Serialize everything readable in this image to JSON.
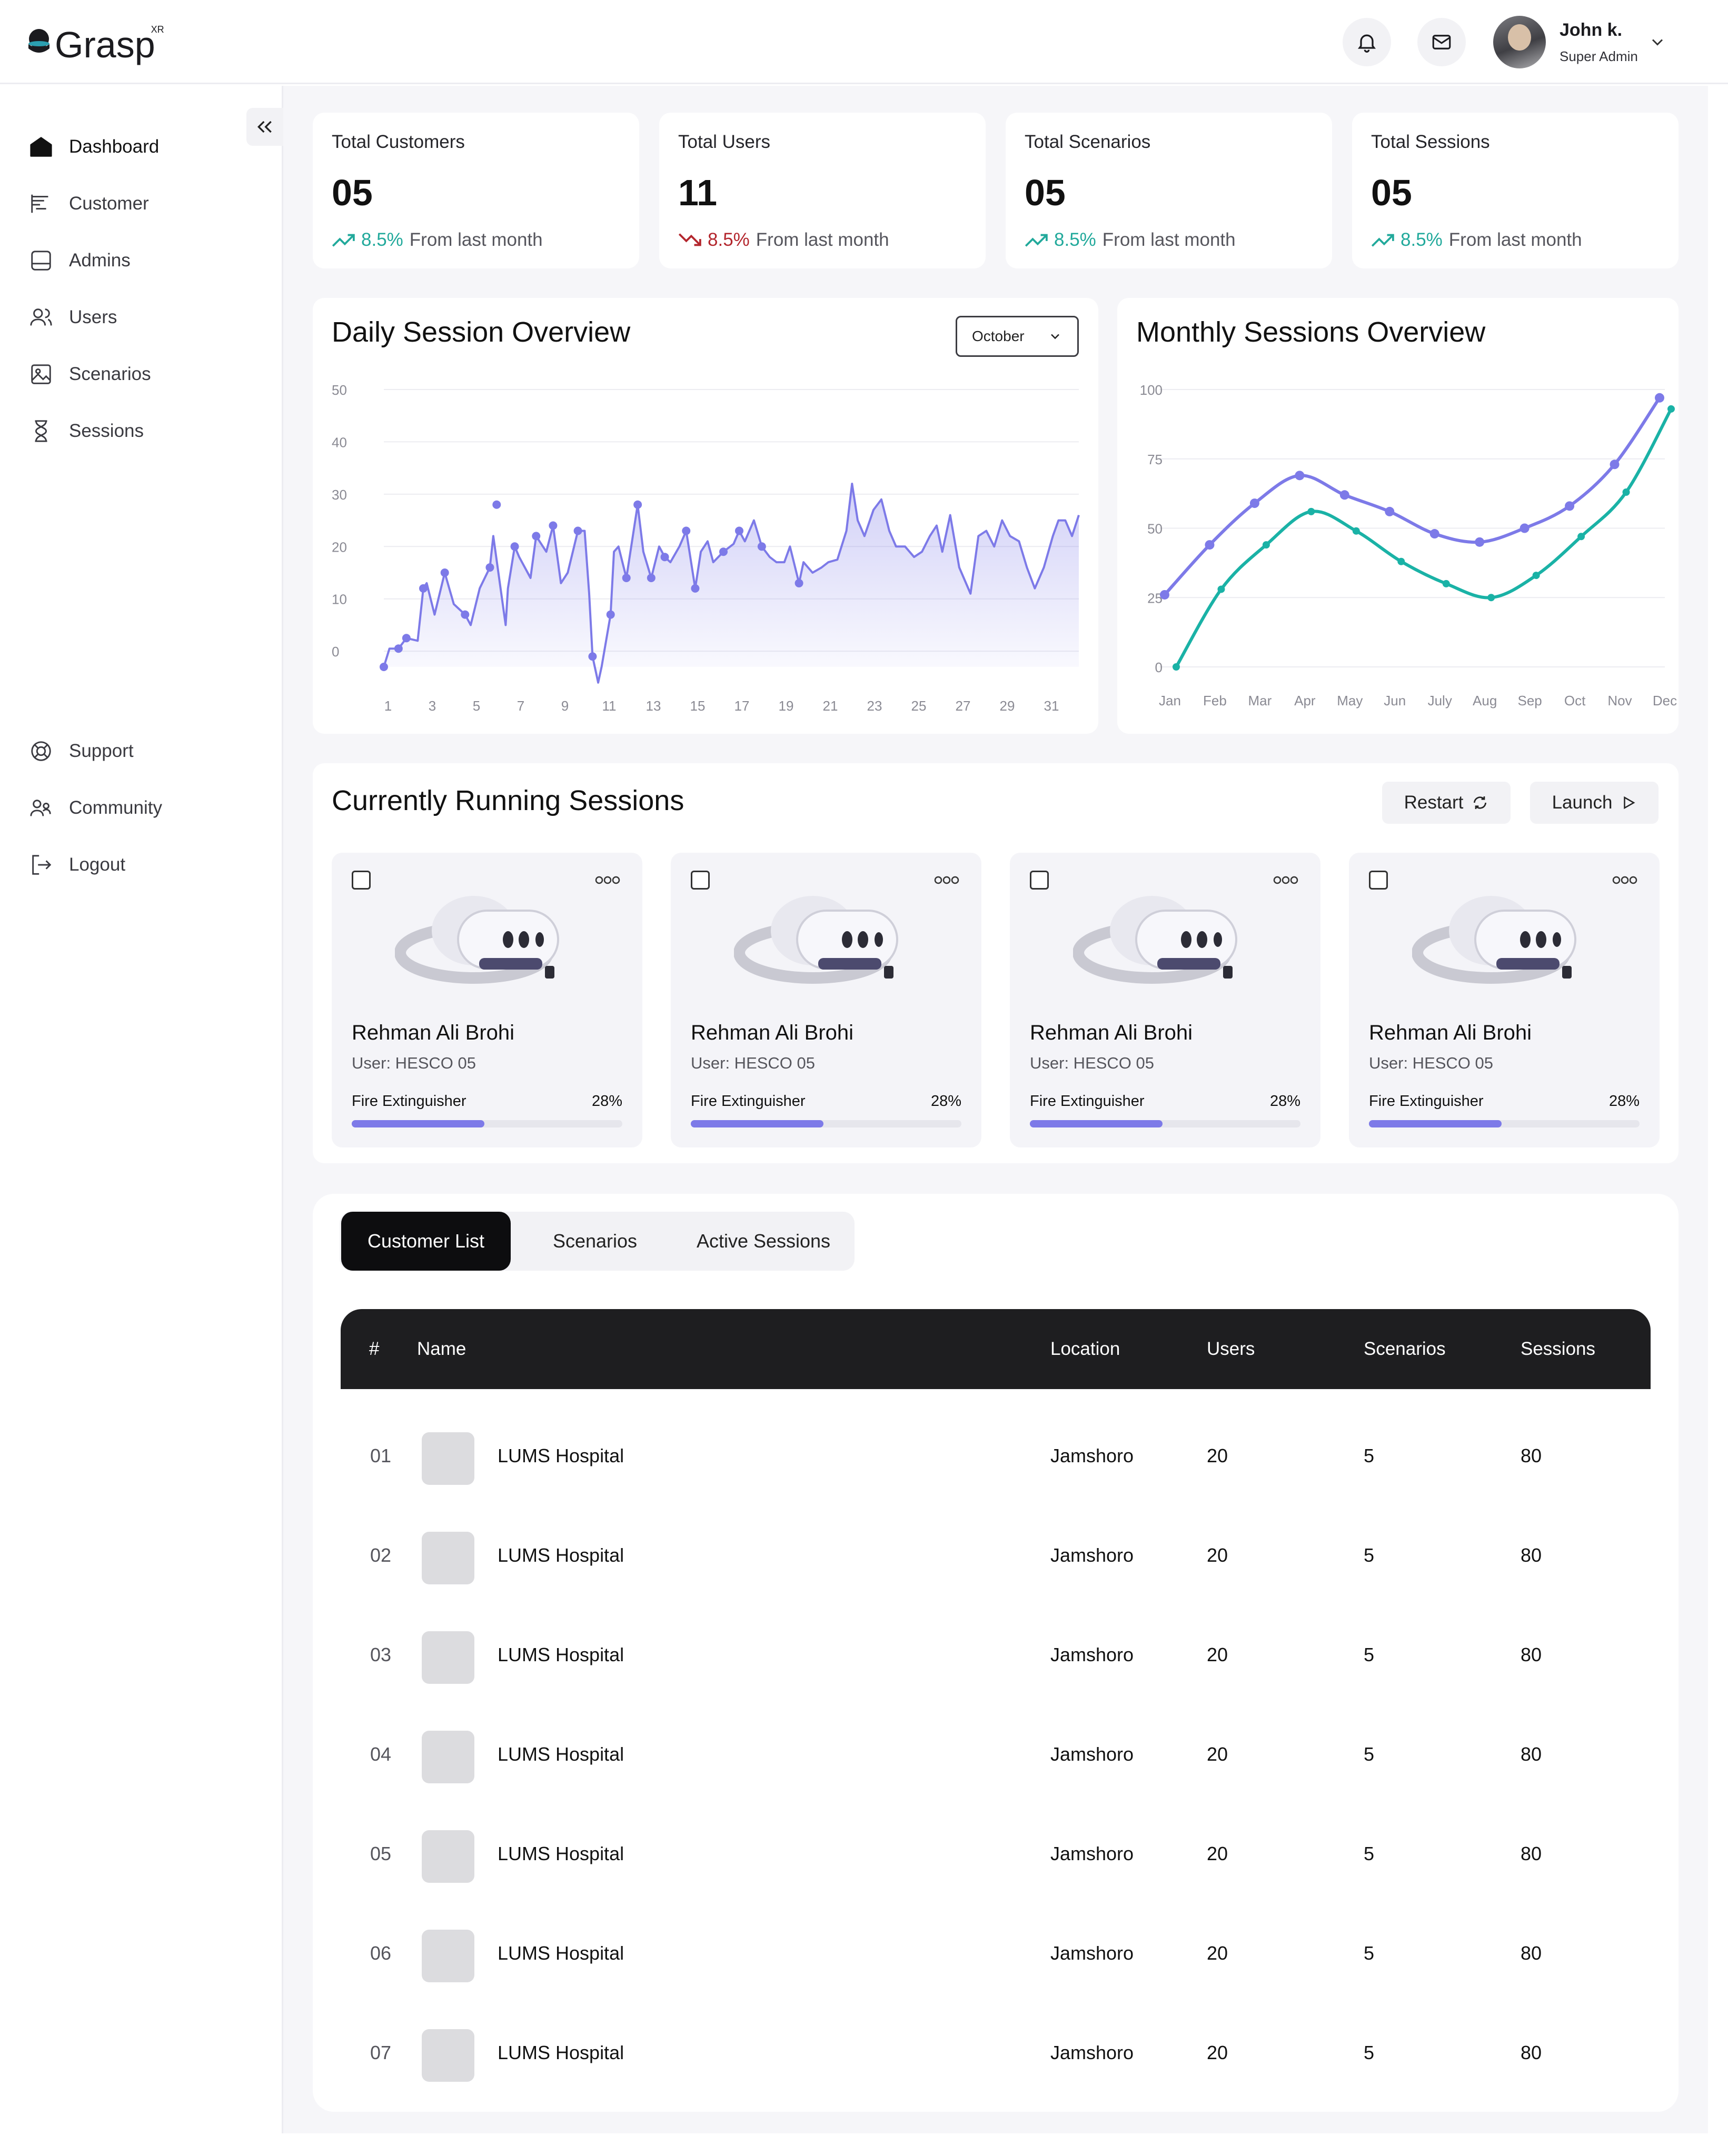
{
  "app": {
    "name": "Grasp",
    "superscript": "XR"
  },
  "header": {
    "user_name": "John k.",
    "user_role": "Super Admin"
  },
  "sidebar": {
    "items": [
      {
        "label": "Dashboard",
        "icon": "home-icon",
        "active": true
      },
      {
        "label": "Customer",
        "icon": "customer-icon"
      },
      {
        "label": "Admins",
        "icon": "admin-icon"
      },
      {
        "label": "Users",
        "icon": "users-icon"
      },
      {
        "label": "Scenarios",
        "icon": "image-icon"
      },
      {
        "label": "Sessions",
        "icon": "hourglass-icon"
      }
    ],
    "bottom_items": [
      {
        "label": "Support",
        "icon": "lifebuoy-icon"
      },
      {
        "label": "Community",
        "icon": "community-icon"
      },
      {
        "label": "Logout",
        "icon": "logout-icon"
      }
    ]
  },
  "stats": [
    {
      "title": "Total Customers",
      "value": "05",
      "pct": "8.5%",
      "suffix": "From last month",
      "trend": "up"
    },
    {
      "title": "Total Users",
      "value": "11",
      "pct": "8.5%",
      "suffix": "From last month",
      "trend": "down"
    },
    {
      "title": "Total Scenarios",
      "value": "05",
      "pct": "8.5%",
      "suffix": "From last month",
      "trend": "up"
    },
    {
      "title": "Total Sessions",
      "value": "05",
      "pct": "8.5%",
      "suffix": "From last month",
      "trend": "up"
    }
  ],
  "colors": {
    "up": "#21a99b",
    "down": "#b3262d",
    "accent": "#7d7ae8",
    "teal": "#1ab2a6"
  },
  "daily": {
    "title": "Daily Session Overview",
    "month": "October"
  },
  "monthly": {
    "title": "Monthly Sessions Overview"
  },
  "chart_data": [
    {
      "type": "area",
      "title": "Daily Session Overview",
      "x_ticks": [
        "1",
        "3",
        "5",
        "7",
        "9",
        "11",
        "13",
        "15",
        "17",
        "19",
        "21",
        "23",
        "25",
        "27",
        "29",
        "31"
      ],
      "y_ticks": [
        "0",
        "10",
        "20",
        "30",
        "40",
        "50"
      ],
      "ylim": [
        -3,
        50
      ],
      "grid": true,
      "points": [
        [
          1,
          -3
        ],
        [
          1.5,
          0.5
        ],
        [
          2.3,
          0.5
        ],
        [
          3,
          2.5
        ],
        [
          4,
          2
        ],
        [
          4.5,
          12
        ],
        [
          4.8,
          13
        ],
        [
          5.5,
          7
        ],
        [
          6.4,
          15
        ],
        [
          7.2,
          9
        ],
        [
          8.2,
          7
        ],
        [
          8.7,
          5
        ],
        [
          9.5,
          12
        ],
        [
          10.4,
          16
        ],
        [
          10.7,
          22
        ],
        [
          11.8,
          5
        ],
        [
          12,
          12
        ],
        [
          12.6,
          20
        ],
        [
          13,
          18
        ],
        [
          14,
          14
        ],
        [
          14.5,
          22
        ],
        [
          15.4,
          19
        ],
        [
          16,
          24
        ],
        [
          16.7,
          13
        ],
        [
          17.3,
          15
        ],
        [
          18.2,
          23
        ],
        [
          18.8,
          23
        ],
        [
          19.2,
          11
        ],
        [
          19.5,
          -1
        ],
        [
          20,
          -6
        ],
        [
          20.3,
          -3
        ],
        [
          21.1,
          7
        ],
        [
          21.4,
          19
        ],
        [
          21.8,
          20
        ],
        [
          22.5,
          14
        ],
        [
          23,
          21
        ],
        [
          23.5,
          28
        ],
        [
          24,
          19
        ],
        [
          24.7,
          14
        ],
        [
          25.4,
          20
        ],
        [
          25.9,
          18
        ],
        [
          26.4,
          17
        ],
        [
          27.2,
          20
        ],
        [
          27.8,
          23
        ],
        [
          28.6,
          12
        ],
        [
          29.1,
          19
        ],
        [
          29.7,
          21
        ],
        [
          30.2,
          17
        ],
        [
          31.1,
          19
        ],
        [
          32,
          20.5
        ],
        [
          32.5,
          23
        ],
        [
          33,
          21
        ],
        [
          33.8,
          25
        ],
        [
          34.5,
          20
        ],
        [
          35.2,
          18
        ],
        [
          35.8,
          17
        ],
        [
          36.5,
          17
        ],
        [
          37,
          20
        ],
        [
          37.8,
          13
        ],
        [
          38.2,
          17
        ],
        [
          39,
          15
        ],
        [
          39.8,
          16
        ],
        [
          40.4,
          17
        ],
        [
          41.2,
          17.5
        ],
        [
          42,
          23
        ],
        [
          42.5,
          32
        ],
        [
          43,
          25
        ],
        [
          43.6,
          22
        ],
        [
          44.4,
          27
        ],
        [
          45.1,
          29
        ],
        [
          45.8,
          23
        ],
        [
          46.4,
          20
        ],
        [
          47.2,
          20
        ],
        [
          48,
          18
        ],
        [
          48.7,
          19
        ],
        [
          49.4,
          22
        ],
        [
          50,
          24
        ],
        [
          50.5,
          19
        ],
        [
          51.2,
          26
        ],
        [
          52,
          16
        ],
        [
          53,
          11
        ],
        [
          53.7,
          22
        ],
        [
          54.4,
          23
        ],
        [
          55.1,
          20
        ],
        [
          55.8,
          25
        ],
        [
          56.5,
          22
        ],
        [
          57.3,
          21
        ],
        [
          58,
          16
        ],
        [
          58.7,
          12
        ],
        [
          59.5,
          16
        ],
        [
          60.3,
          22
        ],
        [
          60.8,
          25
        ],
        [
          61.4,
          25
        ],
        [
          62,
          22
        ],
        [
          62.6,
          26
        ]
      ],
      "markers": [
        [
          1,
          -3
        ],
        [
          2.3,
          0.5
        ],
        [
          3,
          2.5
        ],
        [
          4.5,
          12
        ],
        [
          6.4,
          15
        ],
        [
          8.2,
          7
        ],
        [
          10.4,
          16
        ],
        [
          11,
          28
        ],
        [
          12.6,
          20
        ],
        [
          14.5,
          22
        ],
        [
          16,
          24
        ],
        [
          18.2,
          23
        ],
        [
          19.5,
          -1
        ],
        [
          21.1,
          7
        ],
        [
          22.5,
          14
        ],
        [
          23.5,
          28
        ],
        [
          24.7,
          14
        ],
        [
          25.9,
          18
        ],
        [
          27.8,
          23
        ],
        [
          28.6,
          12
        ],
        [
          31.1,
          19
        ],
        [
          32.5,
          23
        ],
        [
          34.5,
          20
        ],
        [
          37.8,
          13
        ]
      ]
    },
    {
      "type": "line",
      "title": "Monthly Sessions Overview",
      "categories": [
        "Jan",
        "Feb",
        "Mar",
        "Apr",
        "May",
        "Jun",
        "July",
        "Aug",
        "Sep",
        "Oct",
        "Nov",
        "Dec"
      ],
      "y_ticks": [
        "0",
        "25",
        "50",
        "75",
        "100"
      ],
      "ylim": [
        0,
        100
      ],
      "grid": true,
      "series": [
        {
          "color": "#7d7ae8",
          "values": [
            26,
            44,
            59,
            69,
            62,
            56,
            48,
            45,
            50,
            58,
            73,
            97
          ]
        },
        {
          "color": "#1ab2a6",
          "values": [
            0,
            28,
            44,
            56,
            49,
            38,
            30,
            25,
            33,
            47,
            63,
            93
          ]
        }
      ]
    }
  ],
  "running": {
    "title": "Currently Running Sessions",
    "restart_label": "Restart",
    "launch_label": "Launch",
    "cards": [
      {
        "name": "Rehman Ali Brohi",
        "user": "User: HESCO 05",
        "task": "Fire Extinguisher",
        "progress_label": "28%",
        "progress": 0.49
      },
      {
        "name": "Rehman Ali Brohi",
        "user": "User: HESCO 05",
        "task": "Fire Extinguisher",
        "progress_label": "28%",
        "progress": 0.49
      },
      {
        "name": "Rehman Ali Brohi",
        "user": "User: HESCO 05",
        "task": "Fire Extinguisher",
        "progress_label": "28%",
        "progress": 0.49
      },
      {
        "name": "Rehman Ali Brohi",
        "user": "User: HESCO 05",
        "task": "Fire Extinguisher",
        "progress_label": "28%",
        "progress": 0.49
      }
    ]
  },
  "tabs": [
    "Customer List",
    "Scenarios",
    "Active Sessions"
  ],
  "table": {
    "headers": {
      "idx": "#",
      "name": "Name",
      "location": "Location",
      "users": "Users",
      "scenarios": "Scenarios",
      "sessions": "Sessions"
    },
    "rows": [
      {
        "idx": "01",
        "name": "LUMS Hospital",
        "location": "Jamshoro",
        "users": "20",
        "scenarios": "5",
        "sessions": "80"
      },
      {
        "idx": "02",
        "name": "LUMS Hospital",
        "location": "Jamshoro",
        "users": "20",
        "scenarios": "5",
        "sessions": "80"
      },
      {
        "idx": "03",
        "name": "LUMS Hospital",
        "location": "Jamshoro",
        "users": "20",
        "scenarios": "5",
        "sessions": "80"
      },
      {
        "idx": "04",
        "name": "LUMS Hospital",
        "location": "Jamshoro",
        "users": "20",
        "scenarios": "5",
        "sessions": "80"
      },
      {
        "idx": "05",
        "name": "LUMS Hospital",
        "location": "Jamshoro",
        "users": "20",
        "scenarios": "5",
        "sessions": "80"
      },
      {
        "idx": "06",
        "name": "LUMS Hospital",
        "location": "Jamshoro",
        "users": "20",
        "scenarios": "5",
        "sessions": "80"
      },
      {
        "idx": "07",
        "name": "LUMS Hospital",
        "location": "Jamshoro",
        "users": "20",
        "scenarios": "5",
        "sessions": "80"
      }
    ]
  }
}
